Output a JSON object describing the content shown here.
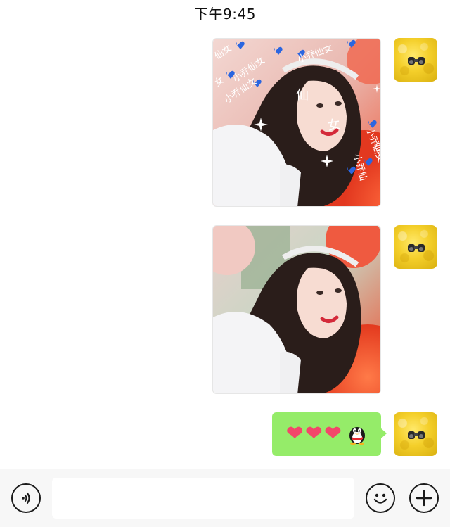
{
  "status_bar": {
    "time": "下午9:45"
  },
  "messages": [
    {
      "type": "image",
      "from": "me",
      "watermark_lines": [
        "仙女",
        "小乔仙女",
        "小乔仙女",
        "女",
        "小乔仙女",
        "仙",
        "女",
        "仙女",
        "小乔仙女",
        "小乔仙"
      ]
    },
    {
      "type": "image",
      "from": "me"
    },
    {
      "type": "text",
      "from": "me",
      "content": "❤❤❤",
      "emoji_icon": "qq-penguin-icon"
    }
  ],
  "input_bar": {
    "voice_icon": "voice-icon",
    "text_value": "",
    "emoji_icon": "smiley-icon",
    "more_icon": "plus-icon"
  },
  "colors": {
    "bubble_green": "#95ec69",
    "heart": "#f2476a",
    "background": "#ffffff",
    "input_bar": "#f7f7f7"
  }
}
